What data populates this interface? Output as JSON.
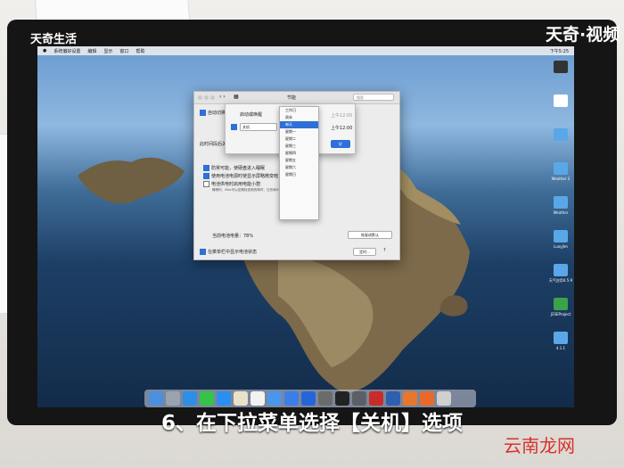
{
  "branding": {
    "left_logo": "天奇生活",
    "right_logo": "天奇·视频",
    "watermark": "云南龙网"
  },
  "caption": "6、在下拉菜单选择【关机】选项",
  "menubar": {
    "items": [
      "系统偏好设置",
      "编辑",
      "显示",
      "窗口",
      "帮助"
    ],
    "clock": "下午5:25"
  },
  "window": {
    "title": "节能",
    "search_placeholder": "搜索",
    "left_labels": [
      "自动切换图形",
      "此时间段后关闭显示器"
    ],
    "options": [
      "防常可能，使硬盘进入睡眠",
      "使用电池电源时使显示屏略微变暗",
      "电池供电时启用电能小憩"
    ],
    "note": "睡眠时，Mac可以定期检查新的邮件、日历和iCloud更新",
    "battery_text": "当前电池电量：78%",
    "restore_button": "恢复成默认",
    "show_battery": "在菜单栏中显示电池状态",
    "schedule_button": "定时...",
    "help": "?"
  },
  "sheet": {
    "startup_label": "启动或唤醒",
    "action_value": "关机",
    "time1": "上午12:00",
    "time2": "上午12:00",
    "ok_button": "好"
  },
  "dropdown": {
    "items": [
      "工作日",
      "周末",
      "每天",
      "星期一",
      "星期二",
      "星期三",
      "星期四",
      "星期五",
      "星期六",
      "星期日"
    ],
    "selected_index": 2
  },
  "desktop_icons": [
    "",
    "",
    "",
    "Weather 2",
    "Weather",
    "LuoyJim",
    "天气应用4.5.9",
    "J2SEProject",
    "4.1.1"
  ],
  "colors": {
    "accent": "#2f6fd8",
    "caption": "#ffffff",
    "watermark": "#d8322a"
  }
}
